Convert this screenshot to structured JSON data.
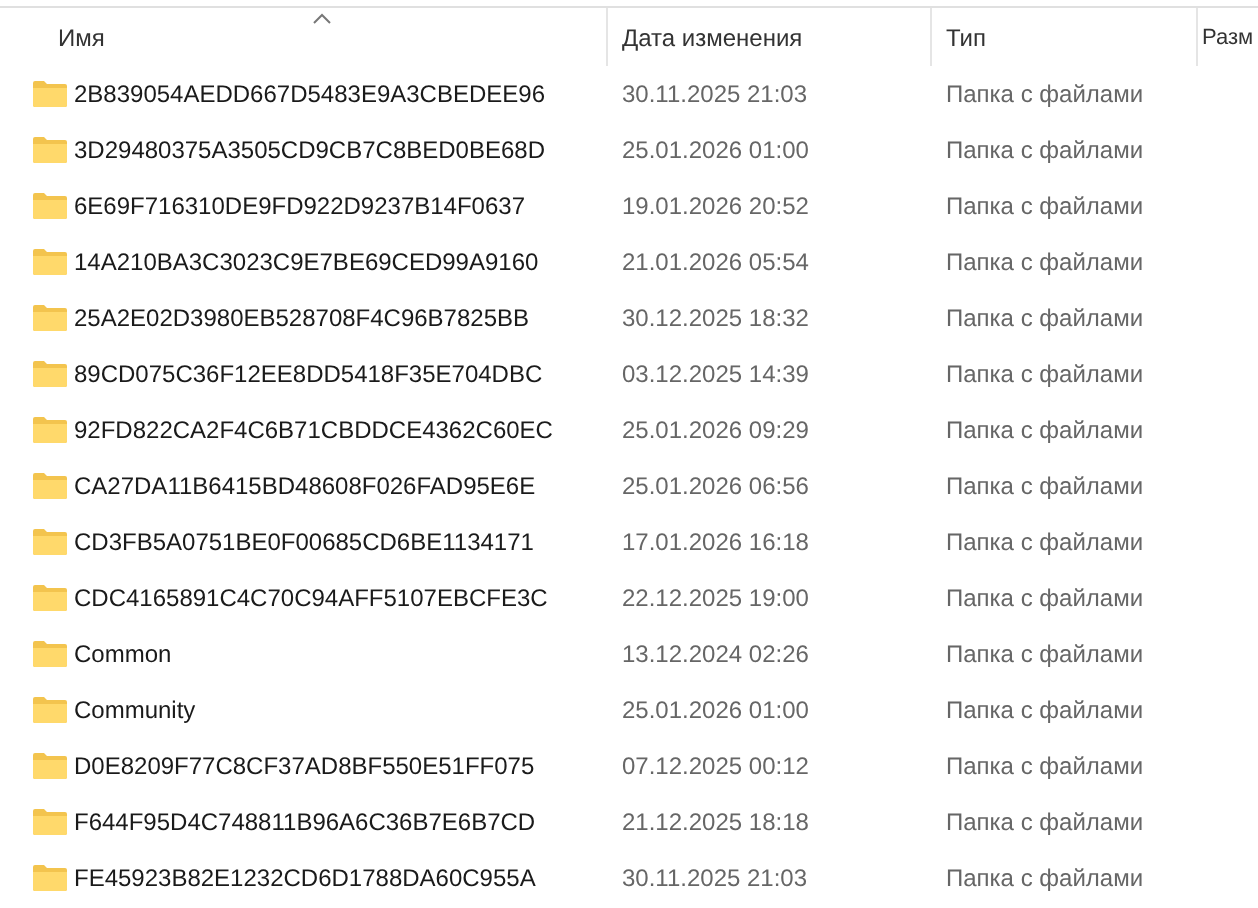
{
  "columns": [
    {
      "label": "Имя",
      "sorted": true
    },
    {
      "label": "Дата изменения",
      "sorted": false
    },
    {
      "label": "Тип",
      "sorted": false
    },
    {
      "label": "Разм",
      "sorted": false
    }
  ],
  "rows": [
    {
      "name": "2B839054AEDD667D5483E9A3CBEDEE96",
      "date": "30.11.2025 21:03",
      "type": "Папка с файлами"
    },
    {
      "name": "3D29480375A3505CD9CB7C8BED0BE68D",
      "date": "25.01.2026 01:00",
      "type": "Папка с файлами"
    },
    {
      "name": "6E69F716310DE9FD922D9237B14F0637",
      "date": "19.01.2026 20:52",
      "type": "Папка с файлами"
    },
    {
      "name": "14A210BA3C3023C9E7BE69CED99A9160",
      "date": "21.01.2026 05:54",
      "type": "Папка с файлами"
    },
    {
      "name": "25A2E02D3980EB528708F4C96B7825BB",
      "date": "30.12.2025 18:32",
      "type": "Папка с файлами"
    },
    {
      "name": "89CD075C36F12EE8DD5418F35E704DBC",
      "date": "03.12.2025 14:39",
      "type": "Папка с файлами"
    },
    {
      "name": "92FD822CA2F4C6B71CBDDCE4362C60EC",
      "date": "25.01.2026 09:29",
      "type": "Папка с файлами"
    },
    {
      "name": "CA27DA11B6415BD48608F026FAD95E6E",
      "date": "25.01.2026 06:56",
      "type": "Папка с файлами"
    },
    {
      "name": "CD3FB5A0751BE0F00685CD6BE1134171",
      "date": "17.01.2026 16:18",
      "type": "Папка с файлами"
    },
    {
      "name": "CDC4165891C4C70C94AFF5107EBCFE3C",
      "date": "22.12.2025 19:00",
      "type": "Папка с файлами"
    },
    {
      "name": "Common",
      "date": "13.12.2024 02:26",
      "type": "Папка с файлами"
    },
    {
      "name": "Community",
      "date": "25.01.2026 01:00",
      "type": "Папка с файлами"
    },
    {
      "name": "D0E8209F77C8CF37AD8BF550E51FF075",
      "date": "07.12.2025 00:12",
      "type": "Папка с файлами"
    },
    {
      "name": "F644F95D4C748811B96A6C36B7E6B7CD",
      "date": "21.12.2025 18:18",
      "type": "Папка с файлами"
    },
    {
      "name": "FE45923B82E1232CD6D1788DA60C955A",
      "date": "30.11.2025 21:03",
      "type": "Папка с файлами"
    }
  ]
}
